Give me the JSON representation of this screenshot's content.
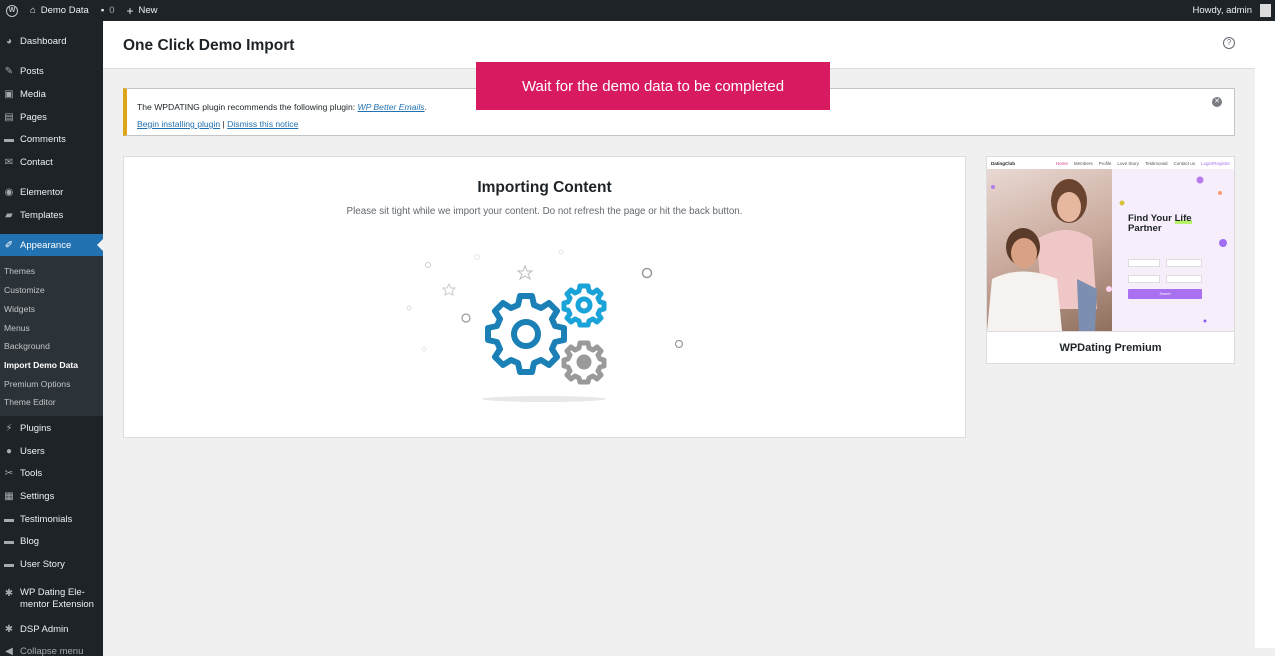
{
  "adminbar": {
    "site_name": "Demo Data",
    "comments_count": "0",
    "new_label": "New",
    "howdy": "Howdy, admin"
  },
  "sidebar": {
    "items": [
      {
        "label": "Dashboard",
        "icon": "dashboard-icon"
      },
      {
        "label": "Posts",
        "icon": "pin-icon"
      },
      {
        "label": "Media",
        "icon": "media-icon"
      },
      {
        "label": "Pages",
        "icon": "page-icon"
      },
      {
        "label": "Comments",
        "icon": "comment-icon"
      },
      {
        "label": "Contact",
        "icon": "mail-icon"
      },
      {
        "label": "Elementor",
        "icon": "elementor-icon"
      },
      {
        "label": "Templates",
        "icon": "folder-icon"
      },
      {
        "label": "Appearance",
        "icon": "brush-icon"
      },
      {
        "label": "Plugins",
        "icon": "plug-icon"
      },
      {
        "label": "Users",
        "icon": "user-icon"
      },
      {
        "label": "Tools",
        "icon": "wrench-icon"
      },
      {
        "label": "Settings",
        "icon": "settings-icon"
      },
      {
        "label": "Testimonials",
        "icon": "comment-icon"
      },
      {
        "label": "Blog",
        "icon": "comment-icon"
      },
      {
        "label": "User Story",
        "icon": "comment-icon"
      },
      {
        "label": "WP Dating Ele-",
        "label2": "mentor Extension",
        "icon": "gear-icon"
      },
      {
        "label": "DSP Admin",
        "icon": "gear-icon"
      },
      {
        "label": "Collapse menu",
        "icon": "collapse-icon"
      }
    ],
    "submenu": [
      "Themes",
      "Customize",
      "Widgets",
      "Menus",
      "Background",
      "Import Demo Data",
      "Premium Options",
      "Theme Editor"
    ]
  },
  "page": {
    "title": "One Click Demo Import"
  },
  "toast": {
    "message": "Wait for the demo data to be completed"
  },
  "notice": {
    "text": "The WPDATING plugin recommends the following plugin: ",
    "plugin_link": "WP Better Emails",
    "period": ".",
    "install_link": "Begin installing plugin",
    "separator": "|",
    "dismiss_link": "Dismiss this notice"
  },
  "import": {
    "title": "Importing Content",
    "subtitle": "Please sit tight while we import your content. Do not refresh the page or hit the back button."
  },
  "theme_card": {
    "name": "WPDating Premium",
    "preview": {
      "logo": "DatingClub",
      "nav": [
        "Home",
        "Members",
        "Profile",
        "Love Story",
        "Testimonial",
        "Contact us",
        "Login/Register"
      ],
      "headline_1": "Find Your",
      "headline_hl": "Life",
      "headline_2": "Partner",
      "search": "Search"
    }
  },
  "colors": {
    "admin_dark": "#1d2327",
    "accent_blue": "#2271b1",
    "toast": "#d81b60",
    "notice_warning": "#dba617",
    "gear_blue": "#1a80b6",
    "gear_grey": "#9a9a9a"
  }
}
